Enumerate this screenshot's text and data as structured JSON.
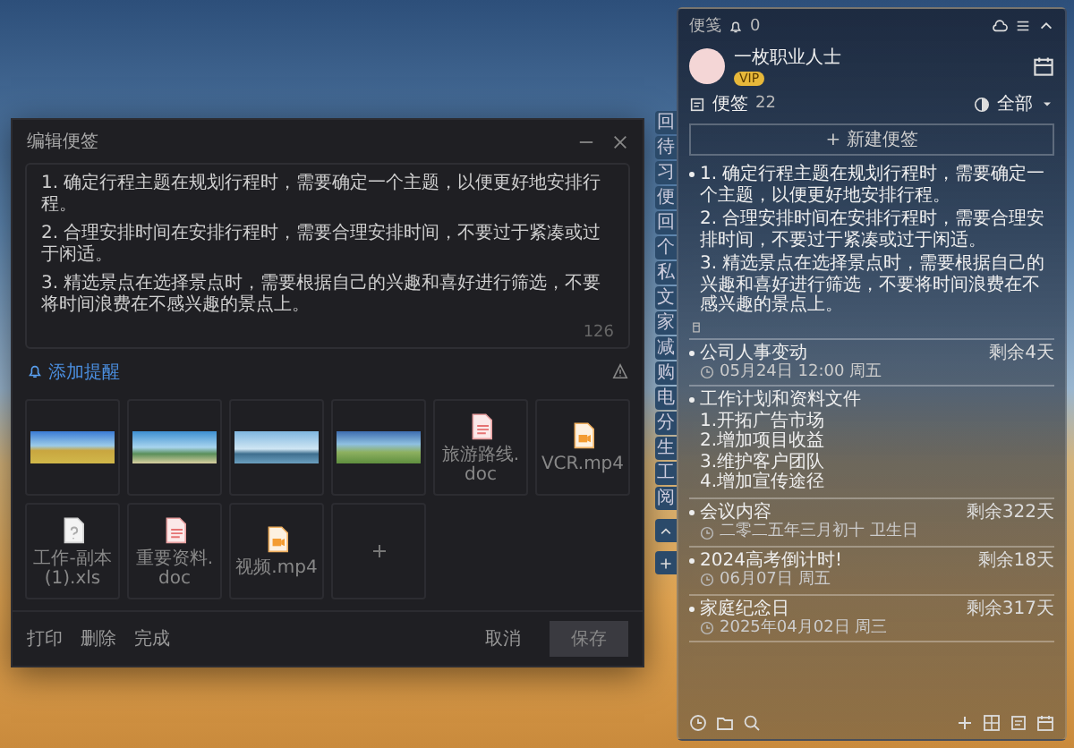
{
  "dialog": {
    "title": "编辑便签",
    "paragraphs": [
      "1. 确定行程主题在规划行程时，需要确定一个主题，以便更好地安排行程。",
      "2. 合理安排时间在安排行程时，需要合理安排时间，不要过于紧凑或过于闲适。",
      "3. 精选景点在选择景点时，需要根据自己的兴趣和喜好进行筛选，不要将时间浪费在不感兴趣的景点上。"
    ],
    "char_count": "126",
    "reminder": "添加提醒",
    "attachments": [
      {
        "kind": "image"
      },
      {
        "kind": "image"
      },
      {
        "kind": "image"
      },
      {
        "kind": "image"
      },
      {
        "kind": "doc",
        "name": "旅游路线.doc"
      },
      {
        "kind": "video",
        "name": "VCR.mp4"
      },
      {
        "kind": "other",
        "name": "工作-副本(1).xls"
      },
      {
        "kind": "doc",
        "name": "重要资料.doc"
      },
      {
        "kind": "video",
        "name": "视频.mp4"
      },
      {
        "kind": "add"
      }
    ],
    "footer_actions": [
      "打印",
      "删除",
      "完成"
    ],
    "buttons": [
      "取消",
      "保存"
    ]
  },
  "panel": {
    "title": "便笺",
    "bell_count": "0",
    "user": {
      "name": "一枚职业人士",
      "badge": "VIP"
    },
    "category": "便签",
    "count": "22",
    "filter": "全部",
    "new_button": "+ 新建便签",
    "side_tabs": [
      "回",
      "待",
      "习",
      "便",
      "回",
      "个",
      "私",
      "文",
      "家",
      "减",
      "购",
      "电",
      "分",
      "生",
      "工",
      "阅"
    ],
    "notes": [
      {
        "kind": "text",
        "paragraphs": [
          "1. 确定行程主题在规划行程时，需要确定一个主题，以便更好地安排行程。",
          "2. 合理安排时间在安排行程时，需要合理安排时间，不要过于紧凑或过于闲适。",
          "3. 精选景点在选择景点时，需要根据自己的兴趣和喜好进行筛选，不要将时间浪费在不感兴趣的景点上。"
        ]
      },
      {
        "kind": "event",
        "countdown": "剩余4天",
        "title": "公司人事变动",
        "date": "05月24日 12:00 周五"
      },
      {
        "kind": "list",
        "title": "工作计划和资料文件",
        "lines": [
          "1.开拓广告市场",
          "2.增加项目收益",
          "3.维护客户团队",
          "4.增加宣传途径"
        ]
      },
      {
        "kind": "event",
        "countdown": "剩余322天",
        "title": "会议内容",
        "date": "二零二五年三月初十 卫生日"
      },
      {
        "kind": "event",
        "countdown": "剩余18天",
        "title": "2024高考倒计时!",
        "date": "06月07日 周五"
      },
      {
        "kind": "event",
        "countdown": "剩余317天",
        "title": "家庭纪念日",
        "date": "2025年04月02日 周三"
      }
    ]
  }
}
